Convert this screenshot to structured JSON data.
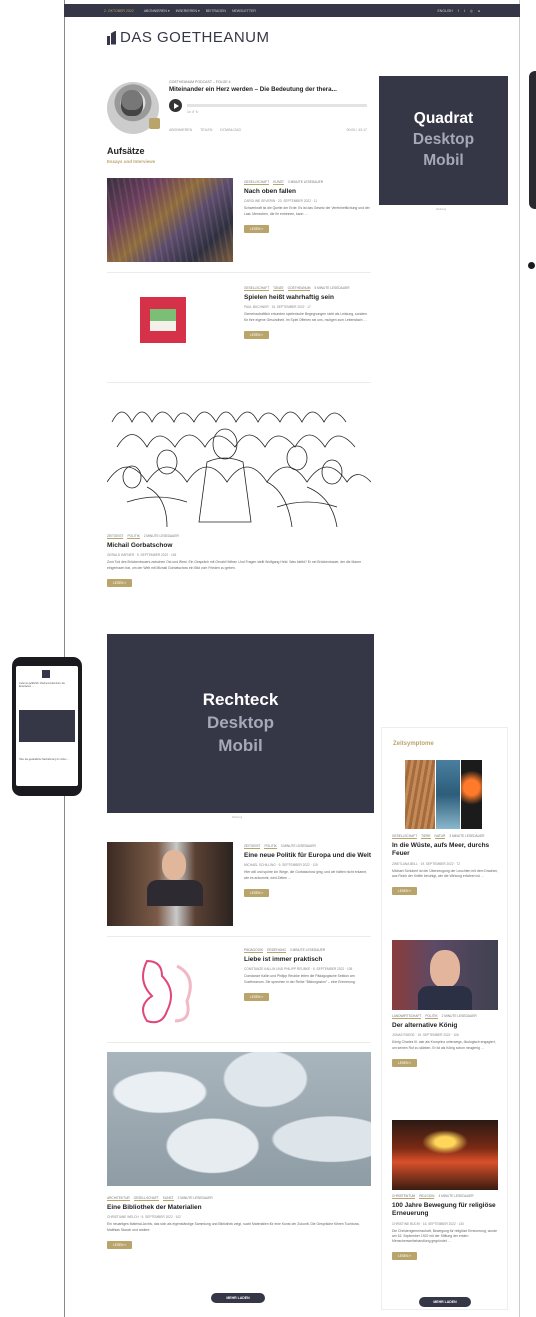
{
  "topbar": {
    "date": "2. OKTOBER 2022",
    "nav": [
      "ABONNIEREN ▾",
      "INSERIEREN ▾",
      "BEITRAGEN",
      "NEWSLETTER"
    ],
    "lang": "ENGLISH",
    "social": [
      "f",
      "t",
      "◎",
      "●"
    ]
  },
  "logo": {
    "text": "DAS GOETHEANUM"
  },
  "podcast": {
    "label": "GOETHEANUM PODCAST – FOLGE 4",
    "title": "Miteinander ein Herz werden – Die Bedeutung der thera...",
    "controls": "1x  ↺  ↻",
    "links": [
      "ABONNIEREN",
      "TEILEN",
      "DOWNLOAD"
    ],
    "time": "00:00 / 43:17"
  },
  "ad_square": {
    "line1": "Quadrat",
    "line2": "Desktop",
    "line3": "Mobil",
    "caption": "Werbung"
  },
  "ad_rect": {
    "line1": "Rechteck",
    "line2": "Desktop",
    "line3": "Mobil",
    "caption": "Werbung"
  },
  "section": {
    "title": "Aufsätze",
    "subtitle": "Essays und Interviews"
  },
  "articles": [
    {
      "tags": [
        "GESELLSCHAFT",
        "KUNST"
      ],
      "read": "3 MINUTE LESEDAUER",
      "title": "Nach oben fallen",
      "meta": "CAROLINE SEVERIN · 23. SEPTEMBER 2022 · 11",
      "excerpt": "Schwerkraft ist die Quelle der Erde: Es ist das Gesetz der Vereinheitlichung und der Last. Menschen, die ihr entrinnen, kann …",
      "button": "LESEN »"
    },
    {
      "tags": [
        "GESELLSCHAFT",
        "TÄNZE",
        "GOETHEANUM"
      ],
      "read": "5 MINUTE LESEDAUER",
      "title": "Spielen heißt wahrhaftig sein",
      "meta": "PAUL BÜCHNER · 15. SEPTEMBER 2022 · 17",
      "excerpt": "Gemeinschaftlich erkunden spielerische Begegnungen nicht als Leistung, sondern für ihre eigene Gesundheit. Im Spiel Offenen sei uns, mutigen zum Lebensfach …",
      "button": "LESEN »"
    },
    {
      "tags": [
        "ZEITGEIST",
        "POLITIK"
      ],
      "read": "2 MINUTE LESEDAUER",
      "title": "Michail Gorbatschow",
      "meta": "GERALD HÄFNER · 9. SEPTEMBER 2022 · 145",
      "excerpt": "Zum Tod des Brückenbauers zwischen Ost und West. Ein Gespräch mit Gerald Häfner. Und Fragen stellt Wolfgang Held. Was bleibt? Er sei Brückenbauer, der die Mauer eingerissen hat, um der Welt mit Michail Gorbatschow ein Bild vom Frieden zu geben.",
      "button": "LESEN »"
    },
    {
      "tags": [
        "ZEITGEIST",
        "POLITIK"
      ],
      "read": "3 MINUTE LESEDAUER",
      "title": "Eine neue Politik für Europa und die Welt",
      "meta": "MICHAEL SCHILLING · 9. SEPTEMBER 2022 · 119",
      "excerpt": "Hier will und spürte ich Wege, die Gorbatschow ging, und wir hätten nicht erkannt, wie es ankommt, wird Zeiten …",
      "button": "LESEN »"
    },
    {
      "tags": [
        "PÄDAGOGIK",
        "ERZIEHUNG"
      ],
      "read": "3 MINUTE LESEDAUER",
      "title": "Liebe ist immer praktisch",
      "meta": "CONSTANZE KALLIN UND PHILIPP REUBKE · 6. SEPTEMBER 2022 · 105",
      "excerpt": "Constanze Kallin und Philipp Reubke leiten die Pädagogische Sektion am Goetheanum. Sie sprechen in der Reihe \"Bildungssinn\" – eine Erinnerung.",
      "button": "LESEN »"
    },
    {
      "tags": [
        "ARCHITEKTUR",
        "GESELLSCHAFT",
        "KUNST"
      ],
      "read": "2 MINUTE LESEDAUER",
      "title": "Eine Bibliothek der Materialien",
      "meta": "CHRISTIANE WELCH · 9. SEPTEMBER 2022 · 102",
      "excerpt": "Ein neuartiges Material-Archiv, das sich als eigenständige Sammlung und Bibliothek zeigt, sucht Materialien für eine Kunst der Zukunft. Die Gespräche führen Tuchtuna, Matthias Stauch und andere.",
      "button": "LESEN »"
    }
  ],
  "load_more": "MEHR LADEN",
  "sidebar": {
    "title": "Zeitsymptome",
    "items": [
      {
        "tags": [
          "GESELLSCHAFT",
          "TIERE",
          "NATUR"
        ],
        "read": "3 MINUTE LESEDAUER",
        "title": "In die Wüste, aufs Meer, durchs Feuer",
        "meta": "ZWETLANA BELL · 19. SEPTEMBER 2022 · 72",
        "excerpt": "Michael Schubert ist der Überzeugung der Leuchten mit dem Drachen, aus Reich der Kräfte beruhigt, wie die Wirkung erfahren ist …",
        "button": "LESEN »"
      },
      {
        "tags": [
          "LANDWIRTSCHAFT",
          "POLITIK"
        ],
        "read": "2 MINUTE LESEDAUER",
        "title": "Der alternative König",
        "meta": "JONAS RÜEDE · 15. SEPTEMBER 2022 · 106",
        "excerpt": "König Charles III. war als Kronprinz unterwegs, ökologisch engagiert, um seinen Ruf zu stärken. Er ist als König schon neugierig …",
        "button": "LESEN »"
      },
      {
        "tags": [
          "CHRISTENTUM",
          "RELIGION"
        ],
        "read": "4 MINUTE LESEDAUER",
        "title": "100 Jahre Bewegung für religiöse Erneuerung",
        "meta": "CHRISTINE BÜCHI · 16. SEPTEMBER 2022 · 130",
        "excerpt": "Die Christengemeinschaft, Bewegung für religiöse Erneuerung, wurde am 16. September 1922 mit der Stiftung der ersten Menschenweihehandlung gegründet …",
        "button": "LESEN »"
      }
    ],
    "load_more": "MEHR LADEN"
  },
  "phone": {
    "text": "Liebe ist gefährlich: Rachenmutternheit, die Erdenleben …",
    "footer": "Über die gedankliche Nachahmung im vollen ..."
  },
  "colors": {
    "dark": "#363746",
    "gold": "#b9a46b"
  }
}
